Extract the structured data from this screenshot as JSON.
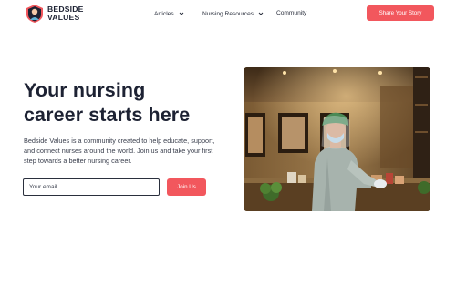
{
  "brand": {
    "name_line1": "BEDSIDE",
    "name_line2": "VALUES",
    "accent": "#f2575d",
    "dark": "#1d2233"
  },
  "nav": {
    "articles": "Articles",
    "resources": "Nursing Resources",
    "community": "Community",
    "cta": "Share Your Story"
  },
  "hero": {
    "title_line1": "Your nursing",
    "title_line2": "career starts here",
    "description": "Bedside Values is a community created to help educate, support, and connect nurses around the world. Join us and take your first step towards a better nursing career.",
    "email_placeholder": "Your email",
    "join_label": "Join Us",
    "image": "nurse-in-ppe-photo"
  }
}
